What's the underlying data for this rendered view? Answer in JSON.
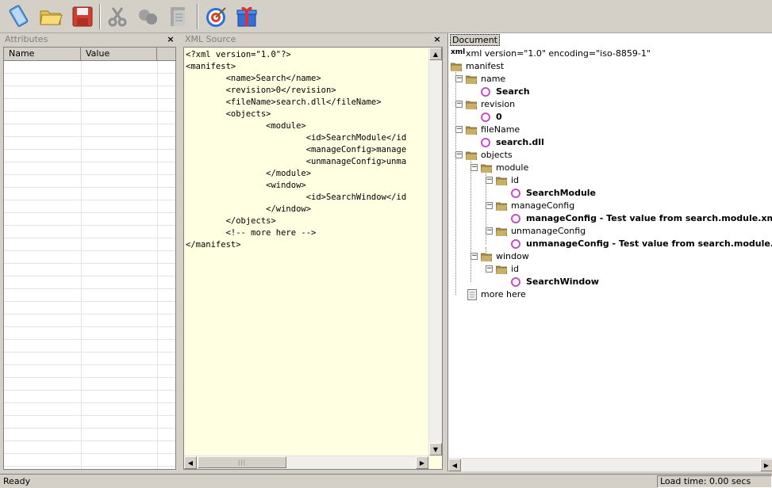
{
  "toolbar": {
    "buttons": [
      {
        "name": "new-document-icon"
      },
      {
        "name": "open-folder-icon"
      },
      {
        "name": "save-disk-icon"
      },
      {
        "name": "cut-scissors-icon"
      },
      {
        "name": "copy-icon"
      },
      {
        "name": "paste-icon"
      },
      {
        "name": "target-icon"
      },
      {
        "name": "gift-box-icon"
      }
    ]
  },
  "attributes_pane": {
    "title": "Attributes",
    "close": "×",
    "columns": [
      "Name",
      "Value"
    ]
  },
  "xml_pane": {
    "title": "XML Source",
    "close": "×",
    "lines": [
      "<?xml version=\"1.0\"?>",
      "<manifest>",
      "        <name>Search</name>",
      "        <revision>0</revision>",
      "        <fileName>search.dll</fileName>",
      "        <objects>",
      "                <module>",
      "                        <id>SearchModule</id",
      "                        <manageConfig>manage",
      "                        <unmanageConfig>unma",
      "                </module>",
      "                <window>",
      "                        <id>SearchWindow</id",
      "                </window>",
      "        </objects>",
      "        <!-- more here -->",
      "</manifest>"
    ]
  },
  "doc_pane": {
    "tab": "Document",
    "declaration": "xml version=\"1.0\" encoding=\"iso-8859-1\"",
    "decl_tag": "xml",
    "nodes": {
      "manifest": "manifest",
      "name": "name",
      "name_val": "Search",
      "revision": "revision",
      "revision_val": "0",
      "fileName": "fileName",
      "fileName_val": "search.dll",
      "objects": "objects",
      "module": "module",
      "id1": "id",
      "id1_val": "SearchModule",
      "manageConfig": "manageConfig",
      "manageConfig_val": "manageConfig - Test value from search.module.xml",
      "unmanageConfig": "unmanageConfig",
      "unmanageConfig_val": "unmanageConfig - Test value from search.module.xml",
      "window": "window",
      "id2": "id",
      "id2_val": "SearchWindow",
      "comment": "more here"
    },
    "toggle_symbol": "−"
  },
  "status": {
    "text": "Ready",
    "load": "Load time: 0.00 secs"
  },
  "scroll_grip": "|||"
}
